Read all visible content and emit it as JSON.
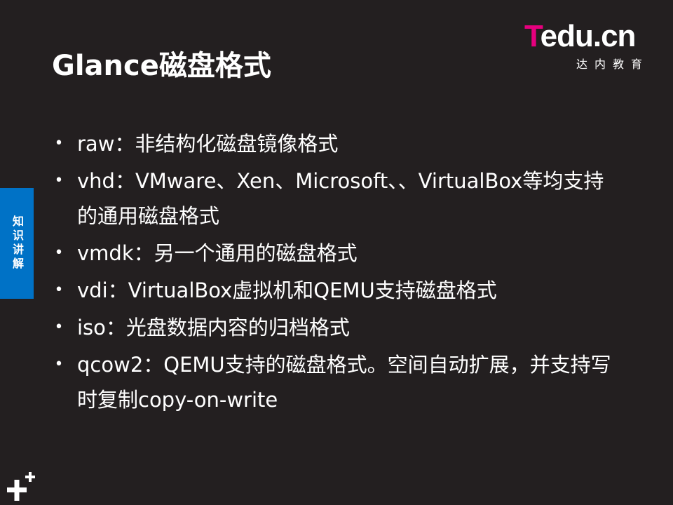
{
  "slide": {
    "title": "Glance磁盘格式",
    "side_tab": "知识讲解",
    "logo": {
      "main_first": "T",
      "main_rest": "edu.cn",
      "sub": "达内教育"
    },
    "bullets": [
      "raw：非结构化磁盘镜像格式",
      "vhd：VMware、Xen、Microsoft、、VirtualBox等均支持的通用磁盘格式",
      "vmdk：另一个通用的磁盘格式",
      "vdi：VirtualBox虚拟机和QEMU支持磁盘格式",
      "iso：光盘数据内容的归档格式",
      "qcow2：QEMU支持的磁盘格式。空间自动扩展，并支持写时复制copy-on-write"
    ],
    "bullet_glyph": "•"
  },
  "colors": {
    "background": "#231f20",
    "accent_blue": "#0072c6",
    "logo_magenta": "#e6007e",
    "text": "#ffffff"
  },
  "icons": {
    "bottom_left": "plus-icon"
  }
}
